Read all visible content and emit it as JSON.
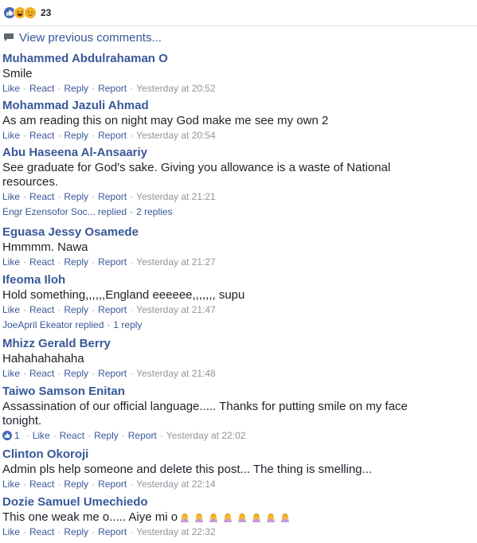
{
  "reactions": {
    "count": "23",
    "icons": [
      "like-icon",
      "haha-icon",
      "sad-icon"
    ],
    "colors": {
      "like": "#4267b2",
      "yellow": "#f7b125"
    }
  },
  "view_previous": "View previous comments...",
  "actions": {
    "like": "Like",
    "react": "React",
    "reply": "Reply",
    "report": "Report",
    "sep": "·"
  },
  "comments": [
    {
      "author": "Muhammed Abdulrahaman O",
      "text": "Smile",
      "time": "Yesterday at 20:52"
    },
    {
      "author": "Mohammad Jazuli Ahmad",
      "text": "As am reading this on night may God make me see my own 2",
      "time": "Yesterday at 20:54"
    },
    {
      "author": "Abu Haseena Al-Ansaariy",
      "text": "See graduate for God's sake. Giving you allowance is a waste of National resources.",
      "time": "Yesterday at 21:21",
      "replies": {
        "who": "Engr Ezensofor Soc... replied",
        "count": "2 replies"
      }
    },
    {
      "author": "Eguasa Jessy Osamede",
      "text": "Hmmmm. Nawa",
      "time": "Yesterday at 21:27"
    },
    {
      "author": "Ifeoma Iloh",
      "text": "Hold something,,,,,,England eeeeee,,,,,,, supu",
      "time": "Yesterday at 21:47",
      "replies": {
        "who": "JoeApril Ekeator replied",
        "count": "1 reply"
      }
    },
    {
      "author": "Mhizz Gerald Berry",
      "text": "Hahahahahaha",
      "time": "Yesterday at 21:48"
    },
    {
      "author": "Taiwo Samson Enitan",
      "text": "Assassination of our official language..... Thanks for putting smile on my face tonight.",
      "time": "Yesterday at 22:02",
      "likes": "1"
    },
    {
      "author": "Clinton Okoroji",
      "text": "Admin pls help someone and delete this post... The thing is smelling...",
      "time": "Yesterday at 22:14"
    },
    {
      "author": "Dozie Samuel Umechiedo",
      "text": "This one weak me o..... Aiye mi o",
      "time": "Yesterday at 22:32",
      "emoji": "person-gesturing-icon",
      "emoji_count": 8
    }
  ]
}
